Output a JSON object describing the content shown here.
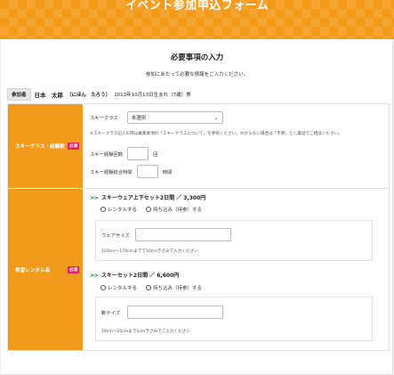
{
  "header": {
    "title": "イベント参加申込フォーム"
  },
  "form": {
    "title": "必要事項の入力",
    "subtitle": "参加にあたって必要な情報をご入力ください。"
  },
  "participant": {
    "label": "参加者",
    "name": "日本　太郎",
    "kana": "（にほん　たろう）",
    "info": "2013年10月13日生まれ（7歳）男"
  },
  "ski_section": {
    "label": "スキークラス・経験数",
    "required": "必須",
    "class_label": "スキークラス",
    "class_value": "未選択",
    "note": "※スキークラス記入の際は募集要項の「スキークラスについて」を参照ください。わからない場合は「不明」とし電話でご相談ください。",
    "count_label": "スキー経験回数",
    "count_unit": "回",
    "hours_label": "スキー経験総合時間",
    "hours_unit": "時間"
  },
  "rental_section": {
    "label": "希望レンタル品",
    "required": "必須",
    "items": [
      {
        "arrow": ">>",
        "title": "スキーウェア上下セット2日間 ／ 3,300円",
        "option_rent": "レンタルする",
        "option_bring": "持ち込み（持参）する",
        "size_label": "ウェアサイズ",
        "size_hint": "120cm〜170cmまでで10cmきざみで入力ください"
      },
      {
        "arrow": ">>",
        "title": "スキーセット2日間 ／ 6,600円",
        "option_rent": "レンタルする",
        "option_bring": "持ち込み（持参）する",
        "size_label": "靴サイズ",
        "size_hint": "19cm〜25cmまで1cmきざみでご入力ください"
      }
    ]
  }
}
